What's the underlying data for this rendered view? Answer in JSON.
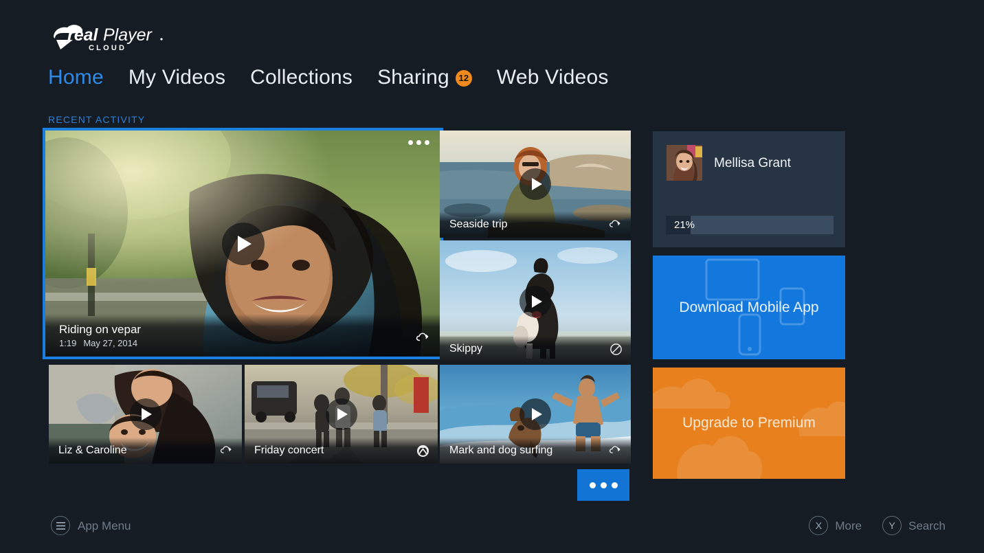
{
  "app": {
    "brand_line1": "real",
    "brand_line2": "Player",
    "brand_sub": "CLOUD",
    "background": "#151c24",
    "accent_blue": "#1b7fe0",
    "accent_orange": "#e8801e"
  },
  "nav": {
    "items": [
      {
        "label": "Home",
        "active": true
      },
      {
        "label": "My Videos",
        "active": false
      },
      {
        "label": "Collections",
        "active": false
      },
      {
        "label": "Sharing",
        "active": false,
        "badge": "12"
      },
      {
        "label": "Web Videos",
        "active": false
      }
    ]
  },
  "section": {
    "label": "RECENT ACTIVITY"
  },
  "tiles": {
    "hero": {
      "title": "Riding on vepar",
      "duration": "1:19",
      "date": "May 27, 2014",
      "sync_icon": "cloud-sync-icon",
      "overflow_icon": "ellipsis-icon",
      "selected": true
    },
    "seaside": {
      "title": "Seaside trip",
      "sync_icon": "cloud-sync-icon"
    },
    "skippy": {
      "title": "Skippy",
      "sync_icon": "no-sync-icon"
    },
    "liz": {
      "title": "Liz & Caroline",
      "sync_icon": "cloud-sync-icon"
    },
    "friday": {
      "title": "Friday concert",
      "sync_icon": "xbox-icon"
    },
    "surf": {
      "title": "Mark and dog surfing",
      "sync_icon": "cloud-sync-icon"
    },
    "more_button": {
      "icon": "ellipsis-icon"
    }
  },
  "rail": {
    "user": {
      "name": "Mellisa Grant",
      "progress_label": "21%",
      "progress_percent": 21,
      "avatar_icon": "avatar"
    },
    "mobile_app": {
      "label": "Download Mobile App"
    },
    "premium": {
      "label": "Upgrade to Premium"
    }
  },
  "statusbar": {
    "app_menu": {
      "label": "App Menu",
      "icon": "hamburger-icon"
    },
    "more": {
      "label": "More",
      "button": "X"
    },
    "search": {
      "label": "Search",
      "button": "Y"
    }
  }
}
